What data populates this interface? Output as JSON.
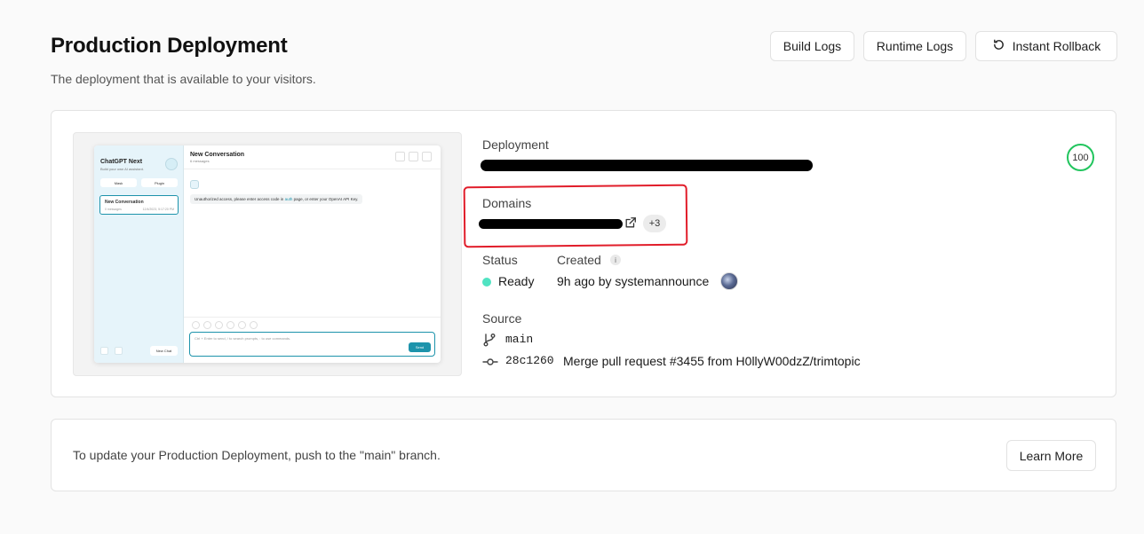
{
  "header": {
    "title": "Production Deployment",
    "subtitle": "The deployment that is available to your visitors.",
    "build_logs": "Build Logs",
    "runtime_logs": "Runtime Logs",
    "instant_rollback": "Instant Rollback"
  },
  "preview": {
    "app_name": "ChatGPT Next",
    "app_tagline": "Build your own AI assistant.",
    "mask_button": "Mask",
    "plugin_button": "Plugin",
    "conversation_title": "New Conversation",
    "conversation_meta_count": "0 messages",
    "conversation_meta_date": "12/4/2023, 5:17:20 PM",
    "chat_title": "New Conversation",
    "chat_subtitle": "6 messages",
    "message_prefix": "Unauthorized access, please enter access code in ",
    "message_link": "auth",
    "message_suffix": " page, or enter your OpenAI API Key.",
    "input_placeholder": "Ctrl + Enter to send, / to search prompts, : to use commands.",
    "send_button": "Send",
    "new_chat_button": "New Chat"
  },
  "details": {
    "deployment_label": "Deployment",
    "score": "100",
    "domains_label": "Domains",
    "domains_more": "+3",
    "status_label": "Status",
    "status_value": "Ready",
    "created_label": "Created",
    "created_value": "9h ago by systemannounce",
    "source_label": "Source",
    "branch": "main",
    "commit_hash": "28c1260",
    "commit_message": "Merge pull request #3455 from H0llyW00dzZ/trimtopic"
  },
  "footer": {
    "text": "To update your Production Deployment, push to the \"main\" branch.",
    "learn_more": "Learn More"
  },
  "colors": {
    "ready": "#50e3c2",
    "score_ring": "#22c55e",
    "highlight": "#e11d2a",
    "accent_teal": "#1d93ab"
  },
  "icons": [
    "rollback-icon",
    "external-link-icon",
    "info-icon",
    "branch-icon",
    "commit-icon"
  ]
}
